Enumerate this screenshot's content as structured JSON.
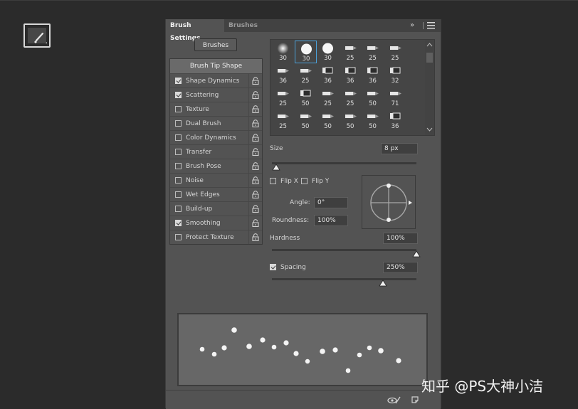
{
  "panel": {
    "tabs": [
      {
        "label": "Brush Settings",
        "active": true
      },
      {
        "label": "Brushes",
        "active": false
      }
    ],
    "collapse_glyph": "»",
    "menu_icon": "hamburger-menu-icon",
    "brushes_button": "Brushes"
  },
  "options": {
    "header": "Brush Tip Shape",
    "items": [
      {
        "label": "Shape Dynamics",
        "checked": true
      },
      {
        "label": "Scattering",
        "checked": true
      },
      {
        "label": "Texture",
        "checked": false
      },
      {
        "label": "Dual Brush",
        "checked": false
      },
      {
        "label": "Color Dynamics",
        "checked": false
      },
      {
        "label": "Transfer",
        "checked": false
      },
      {
        "label": "Brush Pose",
        "checked": false
      },
      {
        "label": "Noise",
        "checked": false
      },
      {
        "label": "Wet Edges",
        "checked": false
      },
      {
        "label": "Build-up",
        "checked": false
      },
      {
        "label": "Smoothing",
        "checked": true
      },
      {
        "label": "Protect Texture",
        "checked": false
      }
    ]
  },
  "presets": {
    "selected_index": 1,
    "items": [
      {
        "kind": "soft",
        "size": "30"
      },
      {
        "kind": "hard",
        "size": "30"
      },
      {
        "kind": "hard",
        "size": "30"
      },
      {
        "kind": "pencil",
        "size": "25"
      },
      {
        "kind": "pencil",
        "size": "25"
      },
      {
        "kind": "pencil",
        "size": "25"
      },
      {
        "kind": "pencil",
        "size": "36"
      },
      {
        "kind": "pencil",
        "size": "25"
      },
      {
        "kind": "marker",
        "size": "36"
      },
      {
        "kind": "marker",
        "size": "36"
      },
      {
        "kind": "marker",
        "size": "36"
      },
      {
        "kind": "marker",
        "size": "32"
      },
      {
        "kind": "pencil",
        "size": "25"
      },
      {
        "kind": "marker",
        "size": "50"
      },
      {
        "kind": "pencil",
        "size": "25"
      },
      {
        "kind": "pencil",
        "size": "25"
      },
      {
        "kind": "pencil",
        "size": "50"
      },
      {
        "kind": "pencil",
        "size": "71"
      },
      {
        "kind": "pencil",
        "size": "25"
      },
      {
        "kind": "pencil",
        "size": "50"
      },
      {
        "kind": "pencil",
        "size": "50"
      },
      {
        "kind": "pencil",
        "size": "50"
      },
      {
        "kind": "pencil",
        "size": "50"
      },
      {
        "kind": "marker",
        "size": "36"
      }
    ]
  },
  "tip_settings": {
    "size_label": "Size",
    "size_value": "8 px",
    "size_level": 0.03,
    "flip_x_label": "Flip X",
    "flip_y_label": "Flip Y",
    "angle_label": "Angle:",
    "angle_value": "0°",
    "roundness_label": "Roundness:",
    "roundness_value": "100%",
    "hardness_label": "Hardness",
    "hardness_value": "100%",
    "hardness_level": 1.0,
    "spacing_label": "Spacing",
    "spacing_value": "250%",
    "spacing_checked": true,
    "spacing_level": 0.77
  },
  "footer_icons": [
    "toggle-visibility-icon",
    "new-preset-icon"
  ],
  "watermark": "知乎 @PS大神小洁",
  "colors": {
    "panel_bg": "#535353",
    "canvas_bg": "#2b2b2b",
    "selection": "#4aa0d8"
  }
}
